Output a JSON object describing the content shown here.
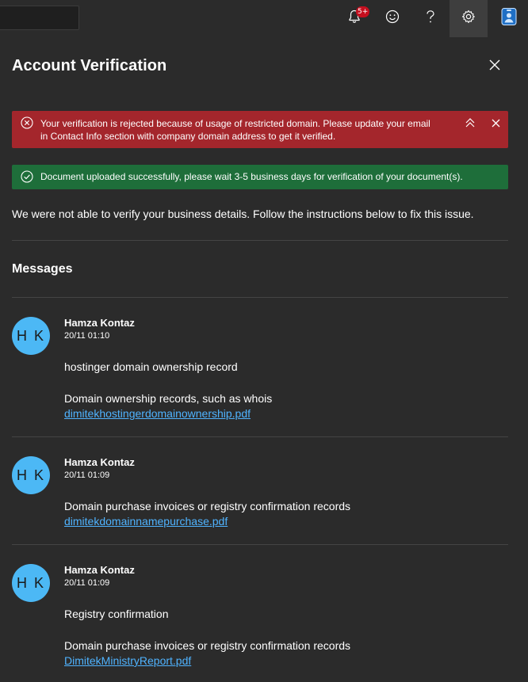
{
  "topbar": {
    "notification_badge": "5+",
    "icons": [
      "bell-icon",
      "smiley-icon",
      "help-icon",
      "gear-icon",
      "user-badge-icon"
    ]
  },
  "panel": {
    "title": "Account Verification"
  },
  "banners": {
    "error_text": "Your verification is rejected because of usage of restricted domain. Please update your email in Contact Info section with company domain address to get it verified.",
    "success_text": "Document uploaded successfully, please wait 3-5 business days for verification of your document(s)."
  },
  "intro_text": "We were not able to verify your business details. Follow the instructions below to fix this issue.",
  "messages_title": "Messages",
  "messages": [
    {
      "initials": "H K",
      "name": "Hamza Kontaz",
      "time": "20/11 01:10",
      "subject": "hostinger domain ownership record",
      "doc_type": "Domain ownership records, such as whois",
      "file": "dimitekhostingerdomainownership.pdf"
    },
    {
      "initials": "H K",
      "name": "Hamza Kontaz",
      "time": "20/11 01:09",
      "doc_type": "Domain purchase invoices or registry confirmation records",
      "file": "dimitekdomainnamepurchase.pdf"
    },
    {
      "initials": "H K",
      "name": "Hamza Kontaz",
      "time": "20/11 01:09",
      "subject": "Registry confirmation",
      "doc_type": "Domain purchase invoices or registry confirmation records",
      "file": "DimitekMinistryReport.pdf"
    }
  ],
  "colors": {
    "background": "#2b2b2b",
    "error": "#a4262c",
    "success": "#1e6e3a",
    "avatar": "#4cb8f5",
    "link": "#4fb3ff"
  }
}
